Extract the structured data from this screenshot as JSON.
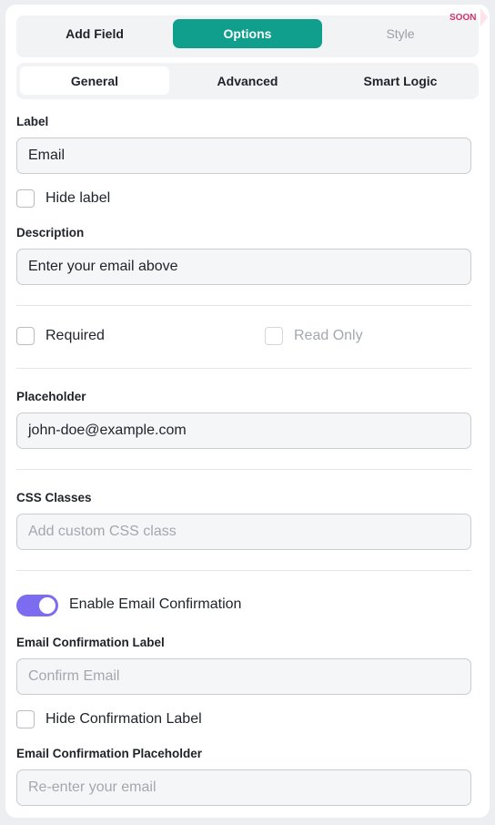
{
  "top_tabs": [
    {
      "label": "Add Field"
    },
    {
      "label": "Options"
    },
    {
      "label": "Style"
    }
  ],
  "soon_badge": "SOON",
  "sub_tabs": [
    {
      "label": "General"
    },
    {
      "label": "Advanced"
    },
    {
      "label": "Smart Logic"
    }
  ],
  "label_section": {
    "title": "Label",
    "value": "Email"
  },
  "hide_label": {
    "text": "Hide label",
    "checked": false
  },
  "description": {
    "title": "Description",
    "value": "Enter your email above"
  },
  "required": {
    "text": "Required",
    "checked": false
  },
  "read_only": {
    "text": "Read Only",
    "checked": false,
    "disabled": true
  },
  "placeholder": {
    "title": "Placeholder",
    "value": "john-doe@example.com"
  },
  "css_classes": {
    "title": "CSS Classes",
    "placeholder": "Add custom CSS class"
  },
  "email_confirmation": {
    "text": "Enable Email Confirmation",
    "enabled": true
  },
  "confirmation_label": {
    "title": "Email Confirmation Label",
    "placeholder": "Confirm Email"
  },
  "hide_confirmation_label": {
    "text": "Hide Confirmation Label",
    "checked": false
  },
  "confirmation_placeholder": {
    "title": "Email Confirmation Placeholder",
    "placeholder": "Re-enter your email"
  },
  "colors": {
    "accent": "#0f9f8c",
    "toggle": "#7c6cf0",
    "soon": "#d6336c"
  }
}
